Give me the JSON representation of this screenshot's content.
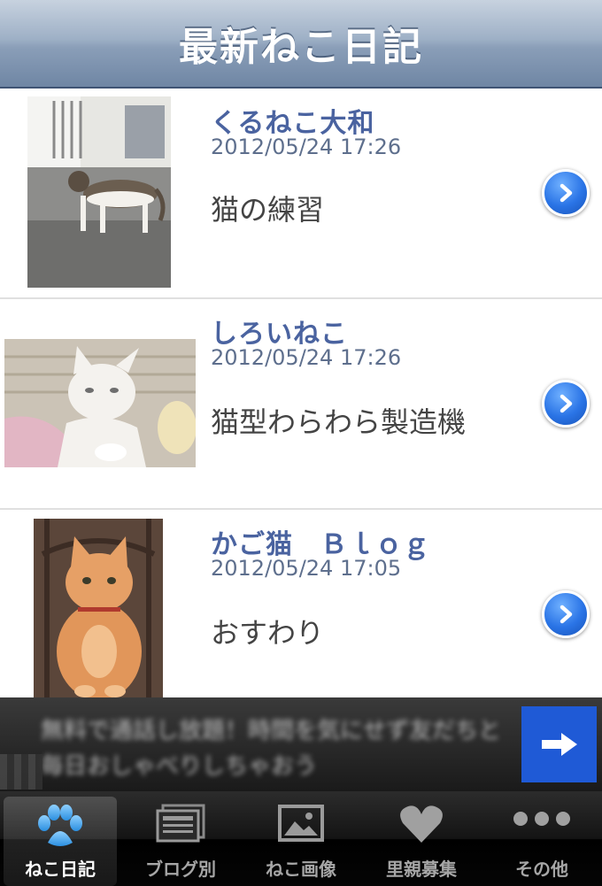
{
  "navbar": {
    "title": "最新ねこ日記"
  },
  "entries": [
    {
      "blog": "くるねこ大和",
      "date": "2012/05/24 17:26",
      "title": "猫の練習"
    },
    {
      "blog": "しろいねこ",
      "date": "2012/05/24 17:26",
      "title": "猫型わらわら製造機"
    },
    {
      "blog": "かご猫　Ｂｌｏｇ",
      "date": "2012/05/24 17:05",
      "title": "おすわり"
    }
  ],
  "ad": {
    "text": "無料で通話し放題！時間を気にせず友だちと毎日おしゃべりしちゃおう",
    "icon": "arrow-right-icon"
  },
  "tabs": [
    {
      "label": "ねこ日記",
      "icon": "paw-icon",
      "active": true
    },
    {
      "label": "ブログ別",
      "icon": "stacked-list-icon",
      "active": false
    },
    {
      "label": "ねこ画像",
      "icon": "image-icon",
      "active": false
    },
    {
      "label": "里親募集",
      "icon": "heart-icon",
      "active": false
    },
    {
      "label": "その他",
      "icon": "more-icon",
      "active": false
    }
  ],
  "colors": {
    "accent": "#4a63a0",
    "disclosure": "#2a74e6",
    "tabbar": "#141414"
  }
}
